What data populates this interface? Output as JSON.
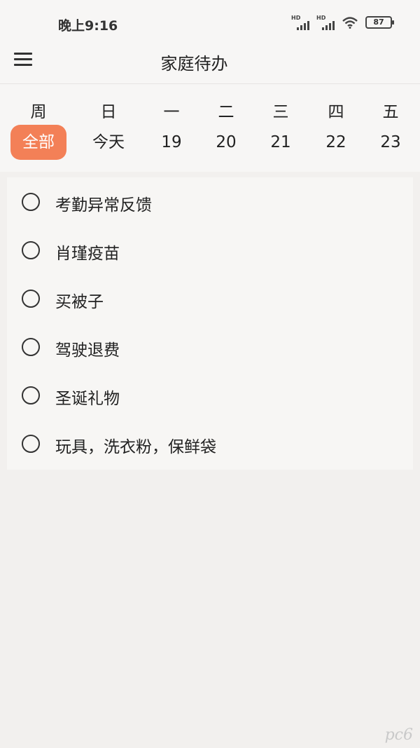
{
  "status_bar": {
    "time": "晚上9:16",
    "battery": "87",
    "hd_label": "HD"
  },
  "app_bar": {
    "title": "家庭待办"
  },
  "week": {
    "days": [
      "周",
      "日",
      "一",
      "二",
      "三",
      "四",
      "五"
    ],
    "dates": [
      "全部",
      "今天",
      "19",
      "20",
      "21",
      "22",
      "23"
    ]
  },
  "todos": [
    {
      "label": "考勤异常反馈"
    },
    {
      "label": "肖瑾疫苗"
    },
    {
      "label": "买被子"
    },
    {
      "label": "驾驶退费"
    },
    {
      "label": "圣诞礼物"
    },
    {
      "label": "玩具，洗衣粉，保鲜袋"
    }
  ],
  "watermark": "pc6",
  "colors": {
    "accent": "#f38057",
    "background": "#f2f0ee"
  }
}
